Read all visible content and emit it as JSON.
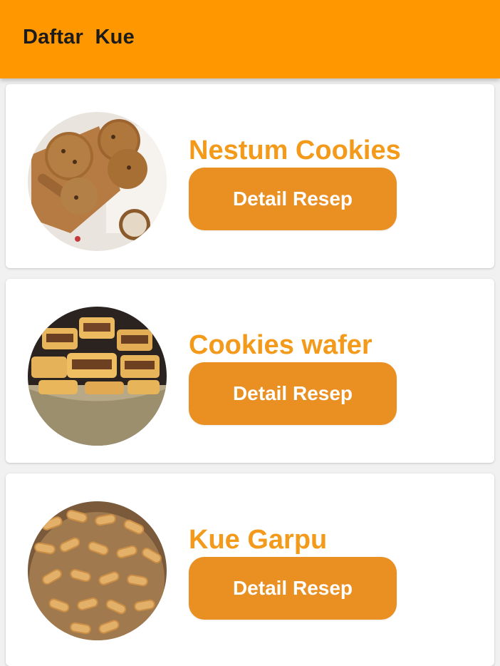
{
  "app_bar": {
    "title": "Daftar  Kue"
  },
  "items": [
    {
      "title": "Nestum Cookies",
      "button_label": "Detail Resep",
      "image": "nestum-cookies-photo"
    },
    {
      "title": "Cookies wafer",
      "button_label": "Detail Resep",
      "image": "cookies-wafer-photo"
    },
    {
      "title": "Kue Garpu",
      "button_label": "Detail Resep",
      "image": "kue-garpu-photo"
    }
  ],
  "colors": {
    "app_bar": "#ff9800",
    "title_text": "#f39a1b",
    "button": "#ea8f22",
    "button_text": "#ffffff",
    "background": "#f1f1f1"
  }
}
